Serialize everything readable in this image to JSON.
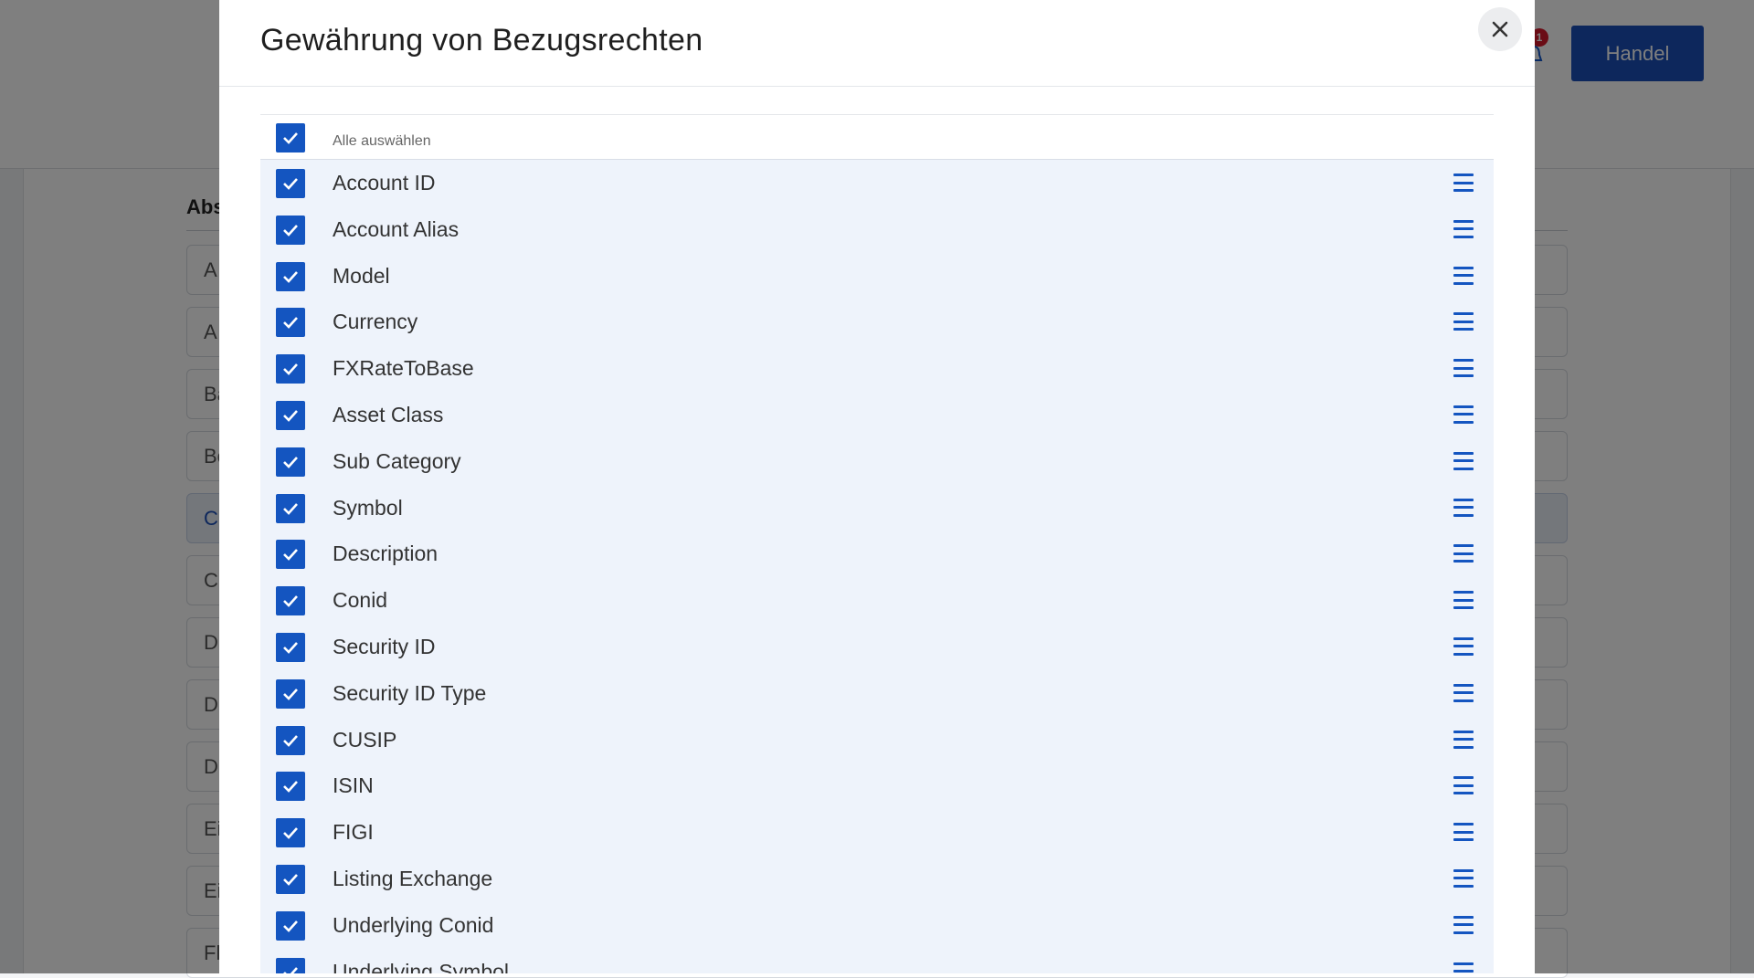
{
  "background": {
    "notification_count": "1",
    "trade_button_label": "Handel",
    "section_title": "Abs",
    "field_fragments": [
      "A",
      "A",
      "Ba",
      "Bo",
      "C",
      "C",
      "D",
      "D",
      "D",
      "Ei",
      "Ei",
      "Fl"
    ]
  },
  "modal": {
    "title": "Gewährung von Bezugsrechten",
    "select_all_label": "Alle auswählen",
    "fields": [
      "Account ID",
      "Account Alias",
      "Model",
      "Currency",
      "FXRateToBase",
      "Asset Class",
      "Sub Category",
      "Symbol",
      "Description",
      "Conid",
      "Security ID",
      "Security ID Type",
      "CUSIP",
      "ISIN",
      "FIGI",
      "Listing Exchange",
      "Underlying Conid",
      "Underlying Symbol"
    ]
  },
  "colors": {
    "accent": "#1455c0",
    "row_background": "#eef3fb",
    "trade_button": "#1a4fb8",
    "badge": "#d4192b"
  }
}
